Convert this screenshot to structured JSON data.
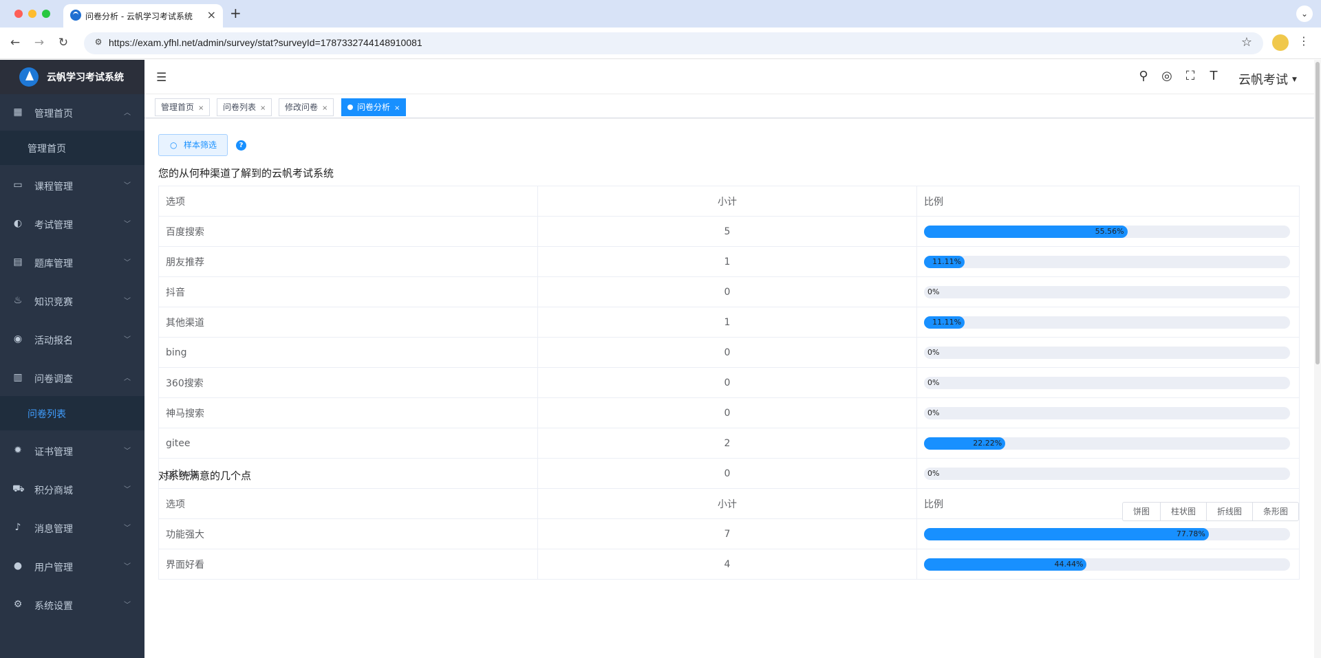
{
  "browser": {
    "tab_title": "问卷分析 - 云帆学习考试系统",
    "tab_close": "×",
    "new_tab": "+",
    "url": "https://exam.yfhl.net/admin/survey/stat?surveyId=1787332744148910081"
  },
  "sidebar": {
    "brand": "云帆学习考试系统",
    "menu": [
      {
        "icon": "dashboard-icon",
        "label": "管理首页",
        "expanded": true,
        "children": [
          {
            "label": "管理首页",
            "active": false
          }
        ]
      },
      {
        "icon": "course-icon",
        "label": "课程管理"
      },
      {
        "icon": "exam-icon",
        "label": "考试管理"
      },
      {
        "icon": "question-bank-icon",
        "label": "题库管理"
      },
      {
        "icon": "fire-icon",
        "label": "知识竞赛"
      },
      {
        "icon": "activity-icon",
        "label": "活动报名"
      },
      {
        "icon": "survey-icon",
        "label": "问卷调查",
        "expanded": true,
        "children": [
          {
            "label": "问卷列表",
            "active": true
          }
        ]
      },
      {
        "icon": "certificate-icon",
        "label": "证书管理"
      },
      {
        "icon": "cart-icon",
        "label": "积分商城"
      },
      {
        "icon": "bell-icon",
        "label": "消息管理"
      },
      {
        "icon": "user-icon",
        "label": "用户管理"
      },
      {
        "icon": "gear-icon",
        "label": "系统设置"
      }
    ]
  },
  "header": {
    "user_name": "云帆考试"
  },
  "tags": [
    {
      "label": "管理首页",
      "active": false
    },
    {
      "label": "问卷列表",
      "active": false
    },
    {
      "label": "修改问卷",
      "active": false
    },
    {
      "label": "问卷分析",
      "active": true
    }
  ],
  "filter_button": "样本筛选",
  "help": "?",
  "columns": {
    "option": "选项",
    "count": "小计",
    "ratio": "比例"
  },
  "questions": [
    {
      "title": "您的从何种渠道了解到的云帆考试系统",
      "rows": [
        {
          "option": "百度搜索",
          "count": "5",
          "ratio": "55.56%",
          "pct": 55.56
        },
        {
          "option": "朋友推荐",
          "count": "1",
          "ratio": "11.11%",
          "pct": 11.11
        },
        {
          "option": "抖音",
          "count": "0",
          "ratio": "0%",
          "pct": 0
        },
        {
          "option": "其他渠道",
          "count": "1",
          "ratio": "11.11%",
          "pct": 11.11
        },
        {
          "option": "bing",
          "count": "0",
          "ratio": "0%",
          "pct": 0
        },
        {
          "option": "360搜索",
          "count": "0",
          "ratio": "0%",
          "pct": 0
        },
        {
          "option": "神马搜索",
          "count": "0",
          "ratio": "0%",
          "pct": 0
        },
        {
          "option": "gitee",
          "count": "2",
          "ratio": "22.22%",
          "pct": 22.22
        },
        {
          "option": "github",
          "count": "0",
          "ratio": "0%",
          "pct": 0
        }
      ]
    },
    {
      "title": "对系统满意的几个点",
      "rows": [
        {
          "option": "功能强大",
          "count": "7",
          "ratio": "77.78%",
          "pct": 77.78
        },
        {
          "option": "界面好看",
          "count": "4",
          "ratio": "44.44%",
          "pct": 44.44
        }
      ]
    }
  ],
  "chart_buttons": [
    "饼图",
    "柱状图",
    "折线图",
    "条形图"
  ],
  "colors": {
    "accent": "#1890ff",
    "sidebar_bg": "#293445",
    "submenu_bg": "#1f2d3d"
  }
}
